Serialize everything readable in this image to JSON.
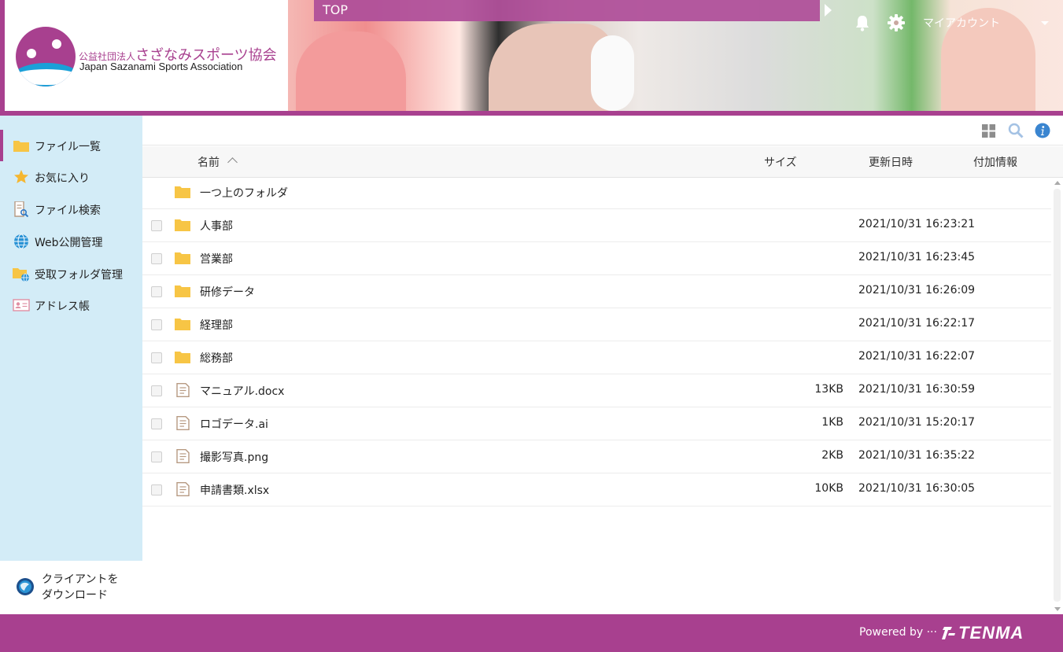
{
  "header": {
    "org_small": "公益社団法人",
    "org_name": "さざなみスポーツ協会",
    "org_en": "Japan Sazanami Sports Association",
    "top_label": "TOP",
    "account_label": "マイアカウント"
  },
  "sidebar": {
    "items": [
      {
        "label": "ファイル一覧",
        "icon": "folder-icon",
        "active": true
      },
      {
        "label": "お気に入り",
        "icon": "star-icon"
      },
      {
        "label": "ファイル検索",
        "icon": "file-search-icon"
      },
      {
        "label": "Web公開管理",
        "icon": "globe-icon"
      },
      {
        "label": "受取フォルダ管理",
        "icon": "folder-globe-icon"
      },
      {
        "label": "アドレス帳",
        "icon": "address-card-icon"
      }
    ],
    "client_download_line1": "クライアントを",
    "client_download_line2": "ダウンロード"
  },
  "columns": {
    "name": "名前",
    "size": "サイズ",
    "updated": "更新日時",
    "extra": "付加情報"
  },
  "parent_folder": "一つ上のフォルダ",
  "files": [
    {
      "name": "人事部",
      "type": "folder",
      "size": "",
      "date": "2021/10/31 16:23:21"
    },
    {
      "name": "営業部",
      "type": "folder",
      "size": "",
      "date": "2021/10/31 16:23:45"
    },
    {
      "name": "研修データ",
      "type": "folder",
      "size": "",
      "date": "2021/10/31 16:26:09"
    },
    {
      "name": "経理部",
      "type": "folder",
      "size": "",
      "date": "2021/10/31 16:22:17"
    },
    {
      "name": "総務部",
      "type": "folder",
      "size": "",
      "date": "2021/10/31 16:22:07"
    },
    {
      "name": "マニュアル.docx",
      "type": "file",
      "size": "13KB",
      "date": "2021/10/31 16:30:59"
    },
    {
      "name": "ロゴデータ.ai",
      "type": "file",
      "size": "1KB",
      "date": "2021/10/31 15:20:17"
    },
    {
      "name": "撮影写真.png",
      "type": "file",
      "size": "2KB",
      "date": "2021/10/31 16:35:22"
    },
    {
      "name": "申請書類.xlsx",
      "type": "file",
      "size": "10KB",
      "date": "2021/10/31 16:30:05"
    }
  ],
  "footer": {
    "powered_by": "Powered by ···",
    "brand": "TENMA"
  },
  "colors": {
    "brand": "#a8408f",
    "sidebar_bg": "#d3ecf7",
    "folder": "#f7c545"
  }
}
